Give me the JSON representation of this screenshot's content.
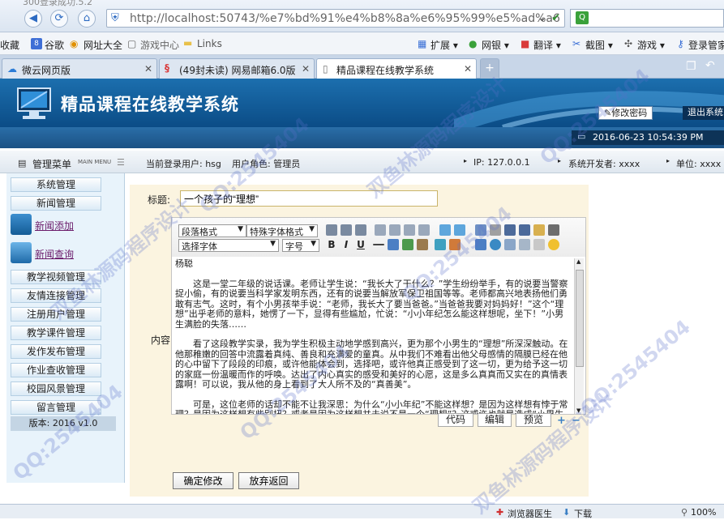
{
  "browser": {
    "old_title": "300登录成功.5.2",
    "url": "http://localhost:50743/%e7%bd%91%e4%b8%8a%e6%95%99%e5%ad%a6",
    "favorites": [
      "收藏",
      "谷歌",
      "网址大全",
      "游戏中心",
      "Links"
    ],
    "extras": [
      "扩展",
      "网银",
      "翻译",
      "截图",
      "游戏",
      "登录管家"
    ],
    "tabs": [
      "微云网页版",
      "(49封未读) 网易邮箱6.0版",
      "精品课程在线教学系统"
    ]
  },
  "site": {
    "title": "精品课程在线教学系统",
    "change_password": "修改密码",
    "logout": "退出系统",
    "datetime": "2016-06-23 10:54:39 PM"
  },
  "info_bar": {
    "menu_label": "管理菜单",
    "menu_sub": "MAIN MENU",
    "current_user": "当前登录用户: hsg",
    "role": "用户角色: 管理员",
    "ip": "IP: 127.0.0.1",
    "developer": "系统开发者: xxxx",
    "unit": "单位: xxxx"
  },
  "sidebar": {
    "top_items": [
      "系统管理",
      "新闻管理"
    ],
    "links": [
      "新闻添加",
      "新闻查询"
    ],
    "items": [
      "教学视频管理",
      "友情连接管理",
      "注册用户管理",
      "教学课件管理",
      "发作发布管理",
      "作业查收管理",
      "校园风景管理",
      "留言管理"
    ],
    "version": "版本: 2016 v1.0"
  },
  "form": {
    "title_label": "标题:",
    "title_value": "一个孩子的“理想”",
    "content_label": "内容",
    "toolbar": {
      "para_format": "段落格式",
      "special_format": "特殊字体格式",
      "font": "选择字体",
      "size": "字号"
    },
    "paragraphs": [
      "杨聪",
      "这是一堂二年级的说话课。老师让学生说：“我长大了干什么？”学生纷纷举手，有的说要当警察捉小偷，有的说要当科学家发明东西，还有的说要当解放军保卫祖国等等。老师都高兴地表扬他们勇敢有志气。这时，有个小男孩举手说：“老师，我长大了要当爸爸。”当爸爸我要对妈妈好！”这个“理想”出乎老师的意料，她愣了一下，显得有些尴尬，忙说：“小小年纪怎么能这样想呢，坐下！”小男生满脸的失落……",
      "看了这段教学实录，我为学生积极主动地学感到高兴，更为那个小男生的“理想”所深深触动。在他那稚嫩的回答中流露着真纯、善良和充满爱的童真。从中我们不难看出他父母感情的隔膜已经在他的心中留下了段段的印痕，或许他能体会到，选择吧，或许他真正感受到了这一切，更为给予这一切的家庭一份温暖而作的呼唤。达出了内心真实的感受和美好的心愿，这是多么真真而又实在的真情表露啊！可以说，我从他的身上看到了大人所不及的“真善美”。",
      "可是，这位老师的话却不能不让我深思：为什么“小小年纪”不能这样想？是因为这样想有悖于常理？是因为这样想有些别扭？或者是因为这样想并未说不是一个“理想”？这或许也就是造成“小男生满脸失落”的原因吧。"
    ],
    "mode_buttons": [
      "代码",
      "编辑",
      "预览"
    ],
    "confirm": "确定修改",
    "back": "放弃返回"
  },
  "status_bar": {
    "items": [
      "浏览器医生",
      "下载",
      "100%"
    ]
  },
  "watermark": [
    "QQ:2545404",
    "双鱼林源码程序设计"
  ]
}
